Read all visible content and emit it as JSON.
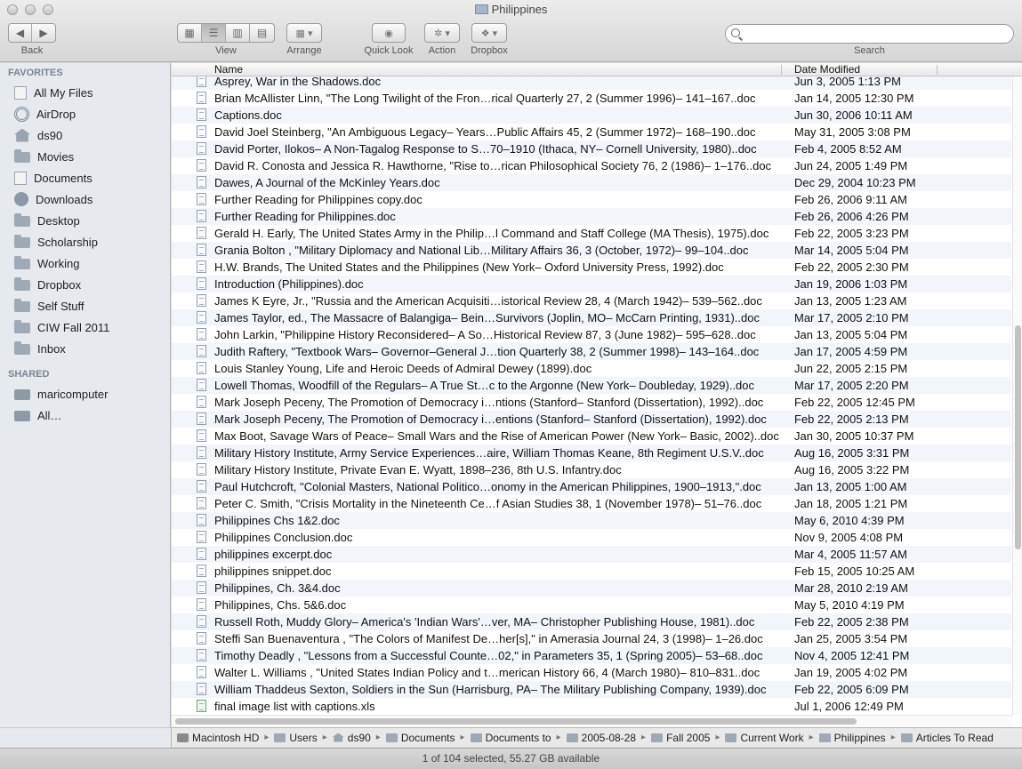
{
  "window": {
    "title": "Philippines"
  },
  "toolbar": {
    "back_label": "Back",
    "view_label": "View",
    "arrange_label": "Arrange",
    "quicklook_label": "Quick Look",
    "action_label": "Action",
    "dropbox_label": "Dropbox",
    "search_label": "Search",
    "search_value": ""
  },
  "sidebar": {
    "favorites_heading": "FAVORITES",
    "favorites": [
      {
        "label": "All My Files",
        "icon": "all-files-icon"
      },
      {
        "label": "AirDrop",
        "icon": "airdrop-icon"
      },
      {
        "label": "ds90",
        "icon": "home-icon"
      },
      {
        "label": "Movies",
        "icon": "folder-icon"
      },
      {
        "label": "Documents",
        "icon": "documents-icon"
      },
      {
        "label": "Downloads",
        "icon": "downloads-icon"
      },
      {
        "label": "Desktop",
        "icon": "desktop-icon"
      },
      {
        "label": "Scholarship",
        "icon": "folder-icon"
      },
      {
        "label": "Working",
        "icon": "folder-icon"
      },
      {
        "label": "Dropbox",
        "icon": "folder-icon"
      },
      {
        "label": "Self Stuff",
        "icon": "folder-icon"
      },
      {
        "label": "CIW Fall 2011",
        "icon": "folder-icon"
      },
      {
        "label": "Inbox",
        "icon": "folder-icon"
      }
    ],
    "shared_heading": "SHARED",
    "shared": [
      {
        "label": "maricomputer",
        "icon": "computer-icon"
      },
      {
        "label": "All…",
        "icon": "network-icon"
      }
    ]
  },
  "columns": {
    "name": "Name",
    "date": "Date Modified"
  },
  "files": [
    {
      "name": "Asprey, War in the Shadows.doc",
      "date": "Jun 3, 2005 1:13 PM"
    },
    {
      "name": "Brian McAllister Linn, \"The Long Twilight of the Fron…rical Quarterly 27, 2 (Summer 1996)– 141–167..doc",
      "date": "Jan 14, 2005 12:30 PM"
    },
    {
      "name": "Captions.doc",
      "date": "Jun 30, 2006 10:11 AM"
    },
    {
      "name": "David Joel Steinberg, \"An Ambiguous Legacy– Years…Public Affairs 45, 2 (Summer 1972)– 168–190..doc",
      "date": "May 31, 2005 3:08 PM"
    },
    {
      "name": "David Porter, Ilokos– A Non-Tagalog Response to S…70–1910 (Ithaca, NY– Cornell University, 1980)..doc",
      "date": "Feb 4, 2005 8:52 AM"
    },
    {
      "name": "David R. Conosta and Jessica R. Hawthorne, \"Rise to…rican Philosophical Society 76, 2 (1986)– 1–176..doc",
      "date": "Jun 24, 2005 1:49 PM"
    },
    {
      "name": "Dawes, A Journal of the McKinley Years.doc",
      "date": "Dec 29, 2004 10:23 PM"
    },
    {
      "name": "Further Reading for Philippines copy.doc",
      "date": "Feb 26, 2006 9:11 AM"
    },
    {
      "name": "Further Reading for Philippines.doc",
      "date": "Feb 26, 2006 4:26 PM"
    },
    {
      "name": "Gerald H. Early, The United States Army in the Philip…l Command and Staff College (MA Thesis), 1975).doc",
      "date": "Feb 22, 2005 3:23 PM"
    },
    {
      "name": "Grania Bolton , \"Military Diplomacy and National Lib…Military Affairs 36, 3 (October, 1972)– 99–104..doc",
      "date": "Mar 14, 2005 5:04 PM"
    },
    {
      "name": "H.W. Brands, The United States and the Philippines (New York– Oxford University Press, 1992).doc",
      "date": "Feb 22, 2005 2:30 PM"
    },
    {
      "name": "Introduction (Philippines).doc",
      "date": "Jan 19, 2006 1:03 PM"
    },
    {
      "name": "James K Eyre, Jr., \"Russia and the American Acquisiti…istorical Review 28, 4 (March 1942)– 539–562..doc",
      "date": "Jan 13, 2005 1:23 AM"
    },
    {
      "name": "James Taylor, ed., The Massacre of Balangiga– Bein…Survivors (Joplin, MO– McCarn Printing, 1931)..doc",
      "date": "Mar 17, 2005 2:10 PM"
    },
    {
      "name": "John Larkin, \"Philippine History Reconsidered– A So…Historical Review 87, 3 (June 1982)– 595–628..doc",
      "date": "Jan 13, 2005 5:04 PM"
    },
    {
      "name": "Judith Raftery, \"Textbook Wars– Governor–General J…tion Quarterly 38, 2 (Summer 1998)– 143–164..doc",
      "date": "Jan 17, 2005 4:59 PM"
    },
    {
      "name": "Louis Stanley Young, Life and Heroic Deeds of Admiral Dewey (1899).doc",
      "date": "Jun 22, 2005 2:15 PM"
    },
    {
      "name": "Lowell Thomas, Woodfill of the Regulars– A True St…c to the Argonne (New York– Doubleday, 1929)..doc",
      "date": "Mar 17, 2005 2:20 PM"
    },
    {
      "name": "Mark Joseph Peceny, The Promotion of Democracy i…ntions (Stanford– Stanford (Dissertation), 1992)..doc",
      "date": "Feb 22, 2005 12:45 PM"
    },
    {
      "name": "Mark Joseph Peceny, The Promotion of Democracy i…entions (Stanford– Stanford (Dissertation), 1992).doc",
      "date": "Feb 22, 2005 2:13 PM"
    },
    {
      "name": "Max Boot, Savage Wars of Peace– Small Wars and the Rise of American Power (New York– Basic, 2002)..doc",
      "date": "Jan 30, 2005 10:37 PM"
    },
    {
      "name": "Military History Institute, Army Service Experiences…aire, William Thomas Keane, 8th Regiment U.S.V..doc",
      "date": "Aug 16, 2005 3:31 PM"
    },
    {
      "name": "Military History Institute, Private Evan E. Wyatt, 1898–236, 8th U.S. Infantry.doc",
      "date": "Aug 16, 2005 3:22 PM"
    },
    {
      "name": "Paul Hutchcroft, \"Colonial Masters, National Politico…onomy in the American Philippines, 1900–1913,\".doc",
      "date": "Jan 13, 2005 1:00 AM"
    },
    {
      "name": "Peter C. Smith, \"Crisis Mortality in the Nineteenth Ce…f Asian Studies 38, 1 (November 1978)– 51–76..doc",
      "date": "Jan 18, 2005 1:21 PM"
    },
    {
      "name": "Philippines Chs 1&2.doc",
      "date": "May 6, 2010 4:39 PM"
    },
    {
      "name": "Philippines Conclusion.doc",
      "date": "Nov 9, 2005 4:08 PM"
    },
    {
      "name": "philippines excerpt.doc",
      "date": "Mar 4, 2005 11:57 AM"
    },
    {
      "name": "philippines snippet.doc",
      "date": "Feb 15, 2005 10:25 AM"
    },
    {
      "name": "Philippines, Ch. 3&4.doc",
      "date": "Mar 28, 2010 2:19 AM"
    },
    {
      "name": "Philippines, Chs. 5&6.doc",
      "date": "May 5, 2010 4:19 PM"
    },
    {
      "name": "Russell Roth, Muddy Glory– America's 'Indian Wars'…ver, MA– Christopher Publishing House, 1981)..doc",
      "date": "Feb 22, 2005 2:38 PM"
    },
    {
      "name": "Steffi San Buenaventura , \"The Colors of Manifest De…her[s],\" in Amerasia Journal 24, 3 (1998)– 1–26.doc",
      "date": "Jan 25, 2005 3:54 PM"
    },
    {
      "name": "Timothy Deadly , \"Lessons from a Successful Counte…02,\" in Parameters 35, 1 (Spring 2005)– 53–68..doc",
      "date": "Nov 4, 2005 12:41 PM"
    },
    {
      "name": "Walter L. Williams , \"United States Indian Policy and t…merican History 66, 4 (March 1980)– 810–831..doc",
      "date": "Jan 19, 2005 4:02 PM"
    },
    {
      "name": "William Thaddeus Sexton, Soldiers in the Sun (Harrisburg, PA– The Military Publishing Company, 1939).doc",
      "date": "Feb 22, 2005 6:09 PM"
    },
    {
      "name": "final image list with captions.xls",
      "date": "Jul 1, 2006 12:49 PM",
      "type": "xls"
    }
  ],
  "pathbar": [
    {
      "label": "Macintosh HD",
      "icon": "hard-drive-icon"
    },
    {
      "label": "Users",
      "icon": "folder-icon"
    },
    {
      "label": "ds90",
      "icon": "home-icon"
    },
    {
      "label": "Documents",
      "icon": "folder-icon"
    },
    {
      "label": "Documents to",
      "icon": "folder-icon"
    },
    {
      "label": "2005-08-28",
      "icon": "folder-icon"
    },
    {
      "label": "Fall 2005",
      "icon": "folder-icon"
    },
    {
      "label": "Current Work",
      "icon": "folder-icon"
    },
    {
      "label": "Philippines",
      "icon": "folder-icon"
    },
    {
      "label": "Articles To Read",
      "icon": "folder-icon"
    }
  ],
  "status": "1 of 104 selected, 55.27 GB available"
}
